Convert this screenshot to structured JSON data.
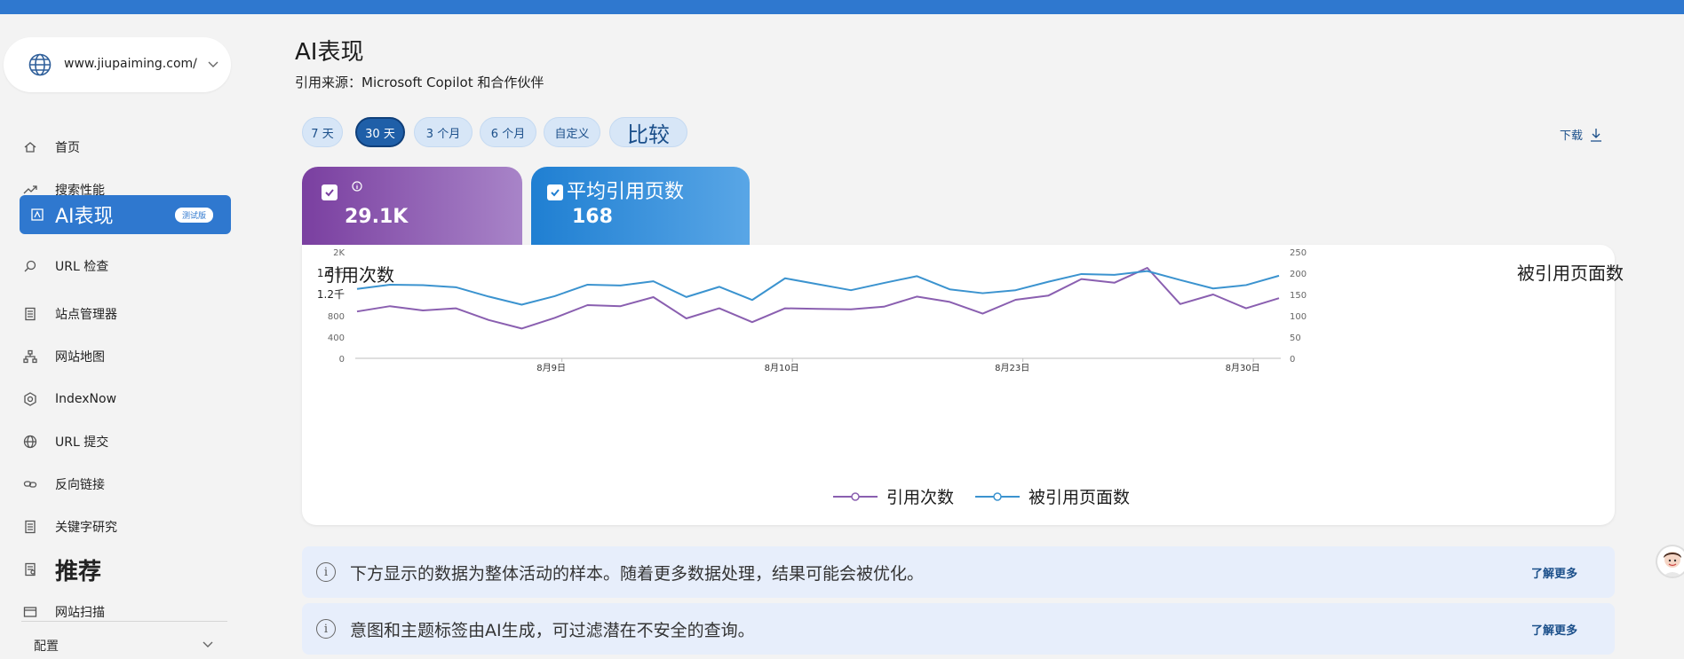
{
  "colors": {
    "brand": "#2f78cf",
    "series_citations": "#8a5fb0",
    "series_pages": "#3b93cf"
  },
  "sidebar": {
    "site_url": "www.jiupaiming.com/",
    "items": [
      {
        "label": "首页",
        "icon": "home-icon"
      },
      {
        "label": "搜索性能",
        "icon": "trend-icon"
      },
      {
        "label": "AI表现",
        "icon": "ai-icon",
        "badge": "测试版"
      },
      {
        "label": "URL 检查",
        "icon": "search-icon"
      },
      {
        "label": "站点管理器",
        "icon": "document-icon"
      },
      {
        "label": "网站地图",
        "icon": "sitemap-icon"
      },
      {
        "label": "IndexNow",
        "icon": "gear-icon"
      },
      {
        "label": "URL 提交",
        "icon": "globe-icon"
      },
      {
        "label": "反向链接",
        "icon": "link-icon"
      },
      {
        "label": "关键字研究",
        "icon": "document-icon"
      },
      {
        "label": "推荐",
        "icon": "document-icon"
      },
      {
        "label": "网站扫描",
        "icon": "scan-icon"
      }
    ],
    "config_label": "配置"
  },
  "main": {
    "title": "AI表现",
    "source": "引用来源：Microsoft Copilot 和合作伙伴",
    "ranges": [
      "7 天",
      "30 天",
      "3 个月",
      "6 个月",
      "自定义",
      "比较"
    ],
    "selected_range": "30 天",
    "download_label": "下载"
  },
  "cards": {
    "citations": {
      "value": "29.1K"
    },
    "pages": {
      "title": "平均引用页数",
      "value": "168"
    }
  },
  "chart_data": {
    "type": "line",
    "ylabel_left": "引用次数",
    "ylabel_right": "被引用页面数",
    "left_ticks": [
      "0",
      "400",
      "800",
      "1.2千",
      "1.6千",
      "2K"
    ],
    "right_ticks": [
      "0",
      "50",
      "100",
      "150",
      "200",
      "250"
    ],
    "ylim_left": [
      0,
      2000
    ],
    "ylim_right": [
      0,
      250
    ],
    "x_tick_labels": [
      "8月9日",
      "8月10日",
      "8月23日",
      "8月30日"
    ],
    "x_tick_index": [
      8,
      17,
      26,
      35
    ],
    "series": [
      {
        "name": "引用次数",
        "axis": "left",
        "values": [
          880,
          980,
          900,
          940,
          720,
          560,
          760,
          1000,
          980,
          1150,
          750,
          940,
          680,
          940,
          930,
          920,
          970,
          1160,
          1060,
          840,
          1100,
          1180,
          1490,
          1420,
          1700,
          1020,
          1200,
          940,
          1130
        ]
      },
      {
        "name": "被引用页面数",
        "axis": "right",
        "values": [
          163,
          173,
          172,
          167,
          145,
          126,
          146,
          173,
          171,
          181,
          144,
          168,
          137,
          188,
          174,
          160,
          177,
          193,
          162,
          153,
          160,
          180,
          198,
          196,
          205,
          184,
          164,
          172,
          194
        ]
      }
    ],
    "grid": false,
    "legend": "bottom-center"
  },
  "notices": [
    {
      "text": "下方显示的数据为整体活动的样本。随着更多数据处理，结果可能会被优化。",
      "link": "了解更多"
    },
    {
      "text": "意图和主题标签由AI生成，可过滤潜在不安全的查询。",
      "link": "了解更多"
    }
  ]
}
